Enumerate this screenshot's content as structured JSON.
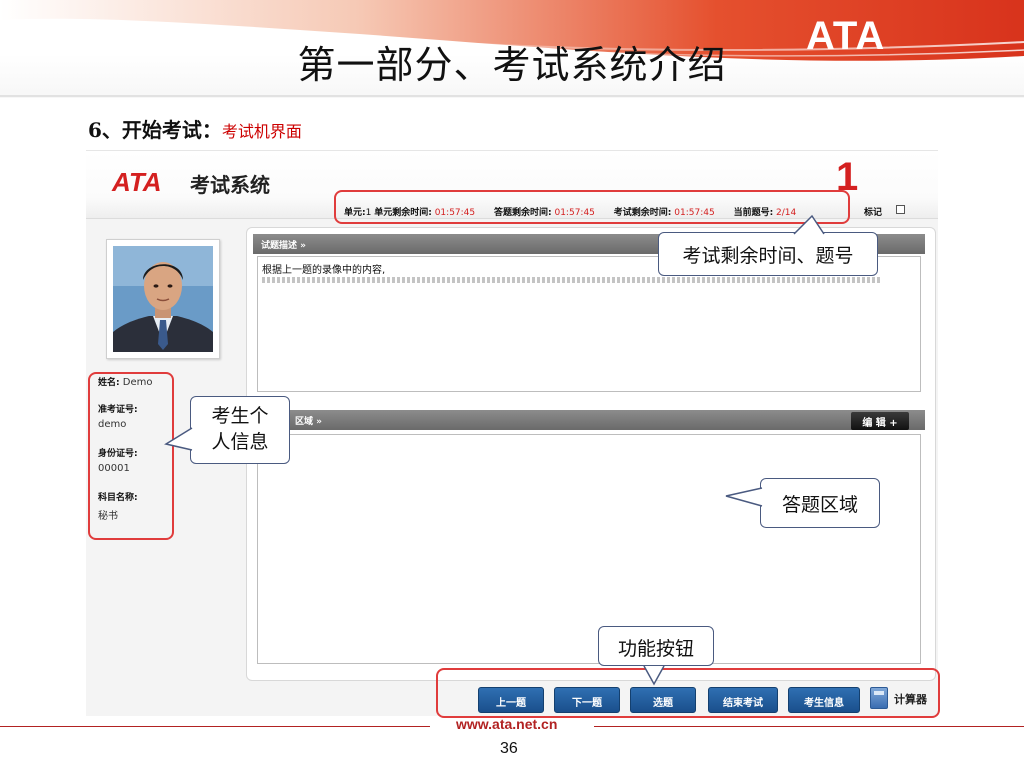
{
  "slide": {
    "title": "第一部分、考试系统介绍",
    "brand": "ATA",
    "subtitle_prefix": "6、开始考试：",
    "subtitle_highlight": "考试机界面",
    "footer_url": "www.ata.net.cn",
    "page_number": "36"
  },
  "app": {
    "logo": "ATA",
    "name": "考试系统",
    "big_number": "1",
    "status": {
      "unit_label": "单元:",
      "unit_value": "1",
      "unit_time_label": "单元剩余时间:",
      "unit_time_value": "01:57:45",
      "answer_time_label": "答题剩余时间:",
      "answer_time_value": "01:57:45",
      "exam_time_label": "考试剩余时间:",
      "exam_time_value": "01:57:45",
      "question_label": "当前题号:",
      "question_value": "2/14",
      "mark_label": "标记"
    },
    "candidate": {
      "name_label": "姓名:",
      "name_value": "Demo",
      "ticket_label": "准考证号:",
      "ticket_value": "demo",
      "id_label": "身份证号:",
      "id_value": "00001",
      "subject_label": "科目名称:",
      "subject_value": "秘书"
    },
    "question_section_title": "试题描述 »",
    "question_text": "根据上一题的录像中的内容,",
    "answer_section_title": "区域 »",
    "edit_button": "编 辑 +",
    "buttons": {
      "prev": "上一题",
      "next": "下一题",
      "select": "选题",
      "finish": "结束考试",
      "info": "考生信息",
      "calculator": "计算器"
    }
  },
  "callouts": {
    "time_and_number": "考试剩余时间、题号",
    "candidate_info_line1": "考生个",
    "candidate_info_line2": "人信息",
    "answer_area": "答题区域",
    "function_buttons": "功能按钮"
  },
  "colors": {
    "accent_red": "#d42020",
    "button_blue": "#1a4f8c",
    "annotation_red": "#e03c3c",
    "callout_border": "#4a5a80"
  }
}
